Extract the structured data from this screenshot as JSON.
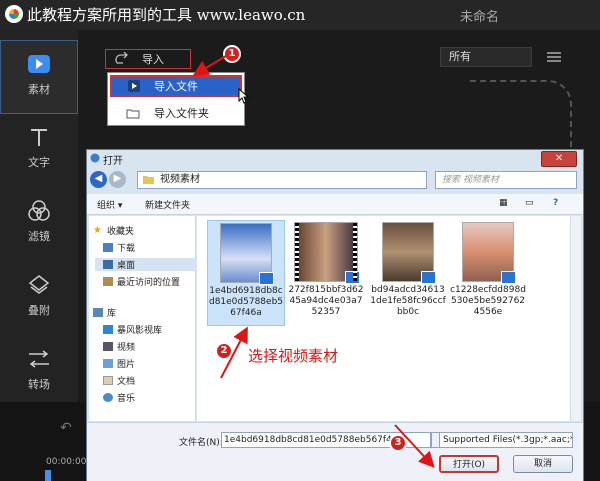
{
  "caption": "此教程方案所用到的工具 www.leawo.cn",
  "window_title": "未命名",
  "rail": [
    {
      "label": "素材",
      "icon": "play-icon"
    },
    {
      "label": "文字",
      "icon": "text-icon"
    },
    {
      "label": "滤镜",
      "icon": "filter-icon"
    },
    {
      "label": "叠附",
      "icon": "overlay-icon"
    },
    {
      "label": "转场",
      "icon": "transition-icon"
    }
  ],
  "import_button": "导入",
  "filter_select": "所有",
  "import_menu": [
    "导入文件",
    "导入文件夹"
  ],
  "timeline_time": "00:00:00",
  "dialog": {
    "title": "打开",
    "address": "视频素材",
    "search_placeholder": "搜索 视频素材",
    "organize": "组织 ▾",
    "new_folder": "新建文件夹",
    "nav_favorites": "收藏夹",
    "nav_items_fav": [
      "下载",
      "桌面",
      "最近访问的位置"
    ],
    "nav_library": "库",
    "nav_items_lib": [
      "暴风影视库",
      "视频",
      "图片",
      "文档",
      "音乐"
    ],
    "files": [
      "1e4bd6918db8cd81e0d5788eb567f46a",
      "272f815bbf3d6245a94dc4e03a752357",
      "bd94adcd346131de1fe58fc96ccfbb0c",
      "c1228ecfdd898d530e5be5927624556e"
    ],
    "filename_label": "文件名(N):",
    "filename_value": "1e4bd6918db8cd81e0d5788eb567f46a",
    "filetype": "Supported Files(*.3gp;*.aac;*",
    "open_button": "打开(O)",
    "cancel_button": "取消"
  },
  "annotation_text": "选择视频素材",
  "badges": [
    "1",
    "2",
    "3"
  ],
  "colors": {
    "annotation": "#e01414",
    "accent": "#2a63c8",
    "bg_dark": "#1e1e1e"
  }
}
